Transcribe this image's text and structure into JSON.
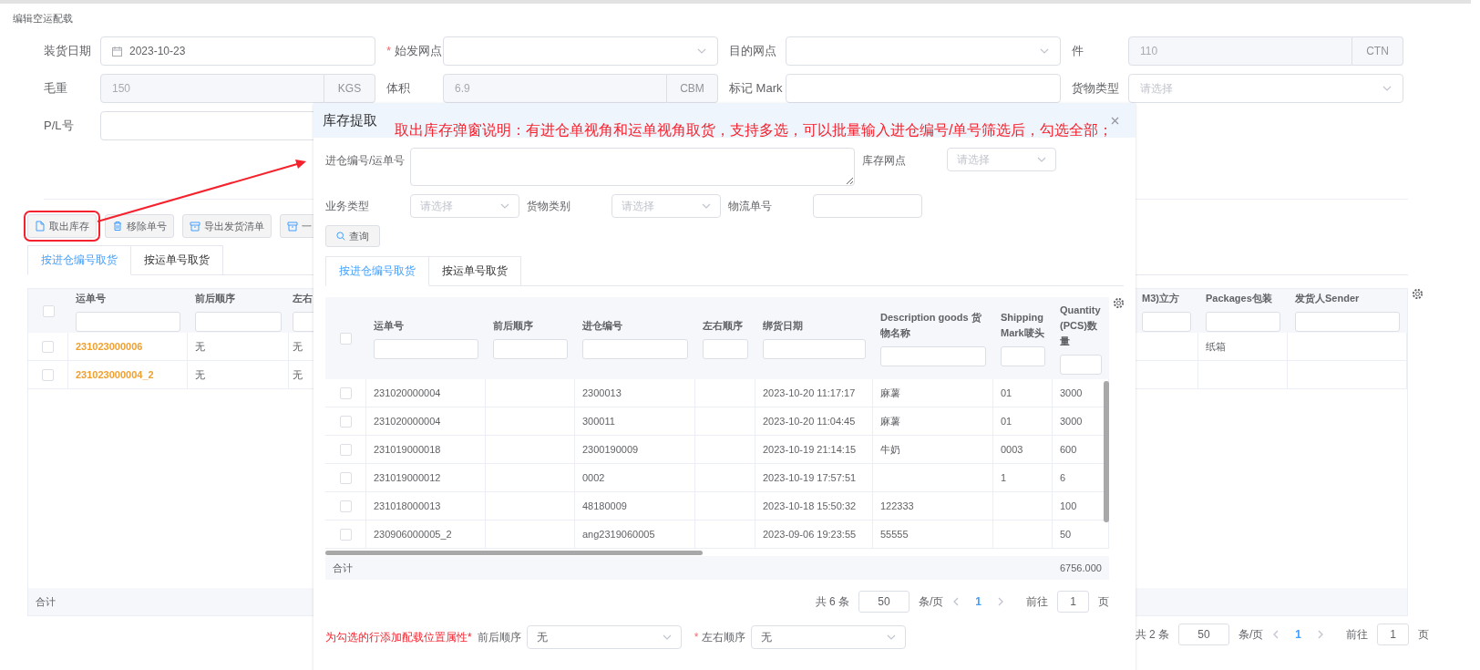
{
  "breadcrumb": "编辑空运配载",
  "form": {
    "rows": [
      [
        {
          "kind": "date",
          "label": "装货日期",
          "value": "2023-10-23"
        },
        {
          "kind": "select",
          "label": "始发网点",
          "required_mark": "*"
        },
        {
          "kind": "select",
          "label": "目的网点"
        },
        {
          "kind": "unit",
          "label": "件",
          "value": "110",
          "unit": "CTN",
          "disabled": true
        }
      ],
      [
        {
          "kind": "unit",
          "label": "毛重",
          "value": "150",
          "unit": "KGS",
          "disabled": true
        },
        {
          "kind": "unit",
          "label": "体积",
          "value": "6.9",
          "unit": "CBM",
          "disabled": true
        },
        {
          "kind": "input",
          "label": "标记 Mark"
        },
        {
          "kind": "select",
          "label": "货物类型",
          "placeholder": "请选择"
        }
      ],
      [
        {
          "kind": "input",
          "label": "P/L号"
        }
      ]
    ]
  },
  "toolbar": [
    {
      "label": "取出库存",
      "highlighted": true
    },
    {
      "label": "移除单号"
    },
    {
      "label": "导出发货清单"
    },
    {
      "label": "一"
    }
  ],
  "tabs": [
    {
      "label": "按进仓编号取货",
      "selected": true
    },
    {
      "label": "按运单号取货",
      "selected": false
    }
  ],
  "table": {
    "all_checked": false,
    "columns": [
      {
        "label": "运单号",
        "kind": "link"
      },
      {
        "label": "前后顺序",
        "kind": "text"
      },
      {
        "label": "左右",
        "kind": "text"
      },
      {
        "label": "M3)立方",
        "kind": "text"
      },
      {
        "label": "Packages包装",
        "kind": "text"
      },
      {
        "label": "发货人Sender",
        "kind": "text"
      }
    ],
    "rows": [
      {
        "checked": false,
        "cells": [
          "231023000006",
          "无",
          "无",
          null,
          "纸箱",
          null
        ]
      },
      {
        "checked": false,
        "cells": [
          "231023000004_2",
          "无",
          "无",
          null,
          null,
          null
        ]
      }
    ],
    "footer": "合计"
  },
  "pagination": {
    "total": "共 2 条",
    "page_size": "50",
    "size_unit": "条/页",
    "pages": [
      {
        "label": "1",
        "selected": true
      }
    ],
    "goto_label": "前往",
    "goto_value": "1",
    "goto_unit": "页"
  },
  "annotation": {
    "text": "取出库存弹窗说明：有进仓单视角和运单视角取货，支持多选，可以批量输入进仓编号/单号筛选后，勾选全部；"
  },
  "modal": {
    "title": "库存提取",
    "filters": [
      [
        {
          "kind": "textarea",
          "label": "进仓编号/运单号"
        },
        {
          "kind": "select",
          "label": "库存网点",
          "placeholder": "请选择"
        }
      ],
      [
        {
          "kind": "select",
          "label": "业务类型",
          "placeholder": "请选择"
        },
        {
          "kind": "select",
          "label": "货物类别",
          "placeholder": "请选择"
        },
        {
          "kind": "input",
          "label": "物流单号"
        }
      ]
    ],
    "query_button": "查询",
    "tabs": [
      {
        "label": "按进仓编号取货",
        "selected": true
      },
      {
        "label": "按运单号取货",
        "selected": false
      }
    ],
    "table": {
      "all_checked": false,
      "columns": [
        "运单号",
        "前后顺序",
        "进仓编号",
        "左右顺序",
        "绑货日期",
        "Description goods 货物名称",
        "Shipping Mark唛头",
        "Quantity (PCS)数量"
      ],
      "rows": [
        {
          "checked": false,
          "cells": [
            "231020000004",
            null,
            "2300013",
            null,
            "2023-10-20 11:17:17",
            "麻薯",
            "01",
            "3000"
          ]
        },
        {
          "checked": false,
          "cells": [
            "231020000004",
            null,
            "300011",
            null,
            "2023-10-20 11:04:45",
            "麻薯",
            "01",
            "3000"
          ]
        },
        {
          "checked": false,
          "cells": [
            "231019000018",
            null,
            "2300190009",
            null,
            "2023-10-19 21:14:15",
            "牛奶",
            "0003",
            "600"
          ]
        },
        {
          "checked": false,
          "cells": [
            "231019000012",
            null,
            "0002",
            null,
            "2023-10-19 17:57:51",
            null,
            "1",
            "6"
          ]
        },
        {
          "checked": false,
          "cells": [
            "231018000013",
            null,
            "48180009",
            null,
            "2023-10-18 15:50:32",
            "122333",
            null,
            "100"
          ]
        },
        {
          "checked": false,
          "cells": [
            "230906000005_2",
            null,
            "ang2319060005",
            null,
            "2023-09-06 19:23:55",
            "55555",
            null,
            "50"
          ]
        }
      ],
      "footer": {
        "label": "合计",
        "quantity": "6756.000"
      }
    },
    "pagination": {
      "total": "共 6 条",
      "page_size": "50",
      "size_unit": "条/页",
      "pages": [
        {
          "label": "1",
          "selected": true
        }
      ],
      "goto_label": "前往",
      "goto_value": "1",
      "goto_unit": "页"
    },
    "bottom": {
      "note": "为勾选的行添加配载位置属性*",
      "fields": [
        {
          "label": "前后顺序",
          "value": "无"
        },
        {
          "label": "左右顺序",
          "required_mark": "*",
          "value": "无"
        }
      ]
    }
  }
}
